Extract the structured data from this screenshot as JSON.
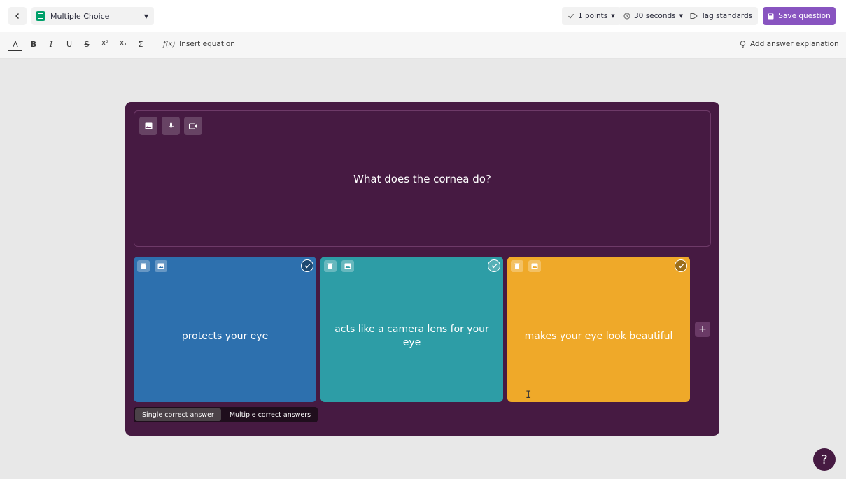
{
  "topbar": {
    "question_type": "Multiple Choice",
    "points_label": "1 points",
    "time_label": "30 seconds",
    "tag_label": "Tag standards",
    "save_label": "Save question"
  },
  "toolbar": {
    "format_buttons": [
      "A",
      "B",
      "I",
      "U",
      "S",
      "X²",
      "X₁",
      "Σ"
    ],
    "insert_equation_icon": "f(x)",
    "insert_equation": "Insert equation",
    "answer_explanation": "Add answer explanation"
  },
  "question": {
    "text": "What does the cornea do?"
  },
  "options": [
    {
      "text": "protects your eye",
      "color": "#2d70ae"
    },
    {
      "text": "acts like a camera lens for your eye",
      "color": "#2d9da6"
    },
    {
      "text": "makes your eye look beautiful",
      "color": "#efa929"
    }
  ],
  "answer_mode": {
    "single": "Single correct answer",
    "multiple": "Multiple correct answers"
  },
  "add_option_label": "+",
  "help_label": "?",
  "colors": {
    "accent": "#8854c0",
    "editor_bg": "#461a42"
  },
  "icons": [
    "chevron-left-icon",
    "checkbox-icon",
    "caret-down-icon",
    "check-icon",
    "clock-icon",
    "tag-icon",
    "save-icon",
    "lightbulb-icon",
    "image-icon",
    "mic-icon",
    "video-icon",
    "trash-icon",
    "plus-icon",
    "help-icon"
  ]
}
